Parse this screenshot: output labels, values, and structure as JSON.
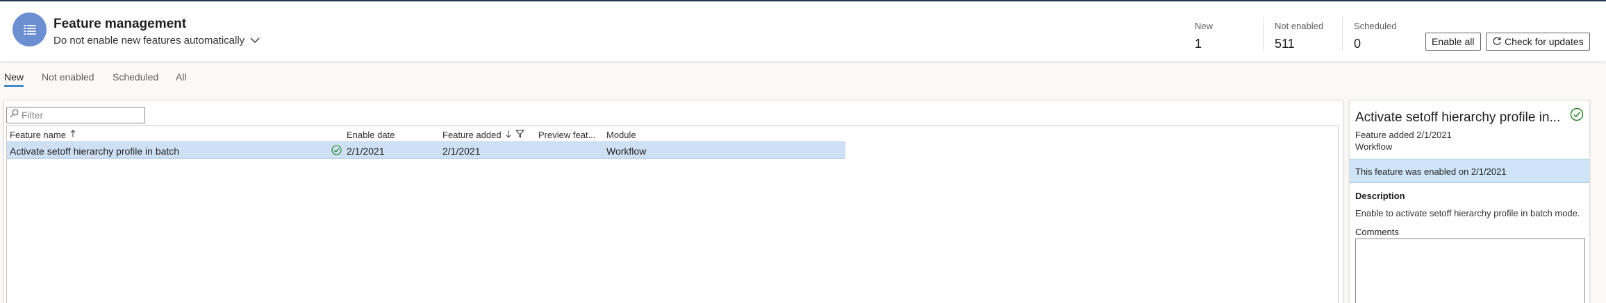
{
  "header": {
    "title": "Feature management",
    "auto_enable_option": "Do not enable new features automatically",
    "stats": [
      {
        "label": "New",
        "value": "1"
      },
      {
        "label": "Not enabled",
        "value": "511"
      },
      {
        "label": "Scheduled",
        "value": "0"
      }
    ],
    "enable_all_label": "Enable all",
    "check_updates_label": "Check for updates"
  },
  "tabs": [
    {
      "label": "New",
      "active": true
    },
    {
      "label": "Not enabled",
      "active": false
    },
    {
      "label": "Scheduled",
      "active": false
    },
    {
      "label": "All",
      "active": false
    }
  ],
  "grid": {
    "filter_placeholder": "Filter",
    "columns": [
      "Feature name",
      "Enable date",
      "Feature added",
      "Preview feat...",
      "Module"
    ],
    "rows": [
      {
        "feature_name": "Activate setoff hierarchy profile in batch",
        "enabled": true,
        "enable_date": "2/1/2021",
        "feature_added": "2/1/2021",
        "preview": "",
        "module": "Workflow"
      }
    ]
  },
  "details": {
    "title": "Activate setoff hierarchy profile in...",
    "feature_added": "Feature added 2/1/2021",
    "module": "Workflow",
    "banner": "This feature was enabled on 2/1/2021",
    "description_label": "Description",
    "description": "Enable to activate setoff hierarchy profile in batch mode.",
    "comments_label": "Comments",
    "comments_value": ""
  },
  "colors": {
    "accent": "#0f6cbd",
    "icon_bg": "#6b8fd0",
    "selected_row": "#cfe0f5",
    "enabled_check": "#107c10"
  }
}
